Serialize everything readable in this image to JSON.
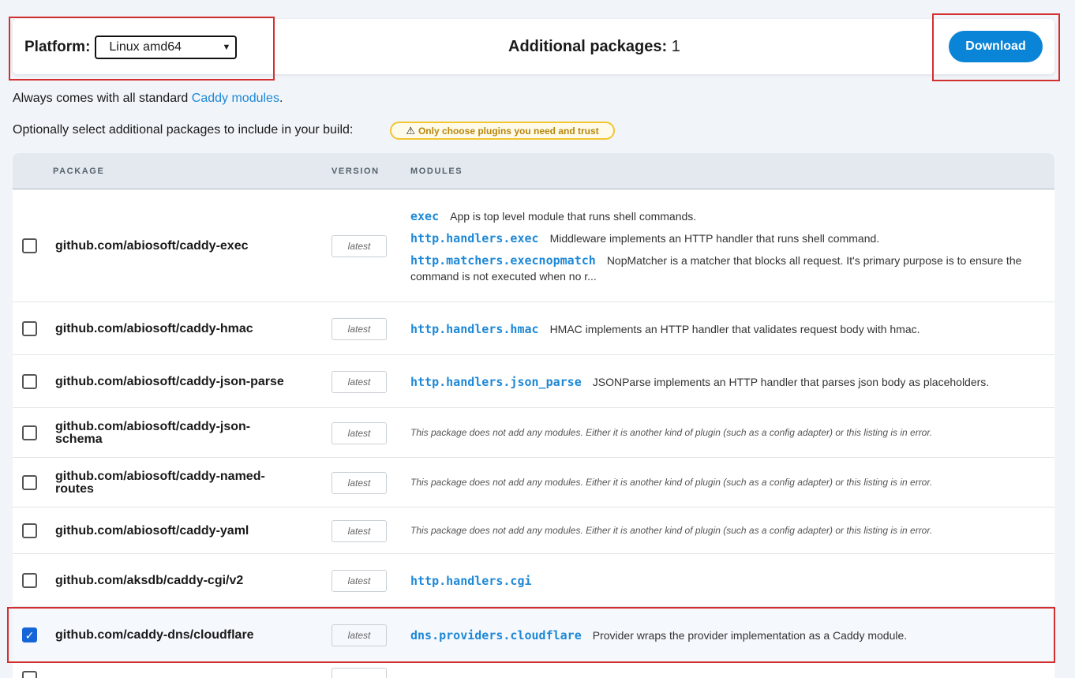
{
  "header": {
    "platform_label": "Platform:",
    "platform_value": "Linux amd64",
    "additional_label": "Additional packages:",
    "additional_count": "1",
    "download_label": "Download"
  },
  "intro": {
    "line1_prefix": "Always comes with all standard ",
    "line1_link": "Caddy modules",
    "line1_suffix": ".",
    "line2": "Optionally select additional packages to include in your build:",
    "warning": "Only choose plugins you need and trust"
  },
  "table": {
    "columns": [
      "PACKAGE",
      "VERSION",
      "MODULES"
    ],
    "no_modules_text": "This package does not add any modules. Either it is another kind of plugin (such as a config adapter) or this listing is in error.",
    "rows": [
      {
        "package": "github.com/abiosoft/caddy-exec",
        "version": "latest",
        "checked": false,
        "modules": [
          {
            "name": "exec",
            "desc": "App is top level module that runs shell commands."
          },
          {
            "name": "http.handlers.exec",
            "desc": "Middleware implements an HTTP handler that runs shell command."
          },
          {
            "name": "http.matchers.execnopmatch",
            "desc": "NopMatcher is a matcher that blocks all request. It's primary purpose is to ensure the command is not executed when no r..."
          }
        ]
      },
      {
        "package": "github.com/abiosoft/caddy-hmac",
        "version": "latest",
        "checked": false,
        "modules": [
          {
            "name": "http.handlers.hmac",
            "desc": "HMAC implements an HTTP handler that validates request body with hmac."
          }
        ]
      },
      {
        "package": "github.com/abiosoft/caddy-json-parse",
        "version": "latest",
        "checked": false,
        "modules": [
          {
            "name": "http.handlers.json_parse",
            "desc": "JSONParse implements an HTTP handler that parses json body as placeholders."
          }
        ]
      },
      {
        "package": "github.com/abiosoft/caddy-json-schema",
        "version": "latest",
        "checked": false,
        "modules": []
      },
      {
        "package": "github.com/abiosoft/caddy-named-routes",
        "version": "latest",
        "checked": false,
        "modules": []
      },
      {
        "package": "github.com/abiosoft/caddy-yaml",
        "version": "latest",
        "checked": false,
        "modules": []
      },
      {
        "package": "github.com/aksdb/caddy-cgi/v2",
        "version": "latest",
        "checked": false,
        "modules": [
          {
            "name": "http.handlers.cgi",
            "desc": ""
          }
        ]
      },
      {
        "package": "github.com/caddy-dns/cloudflare",
        "version": "latest",
        "checked": true,
        "modules": [
          {
            "name": "dns.providers.cloudflare",
            "desc": "Provider wraps the provider implementation as a Caddy module."
          }
        ]
      },
      {
        "package": "",
        "version": "",
        "checked": false,
        "modules": []
      }
    ]
  }
}
